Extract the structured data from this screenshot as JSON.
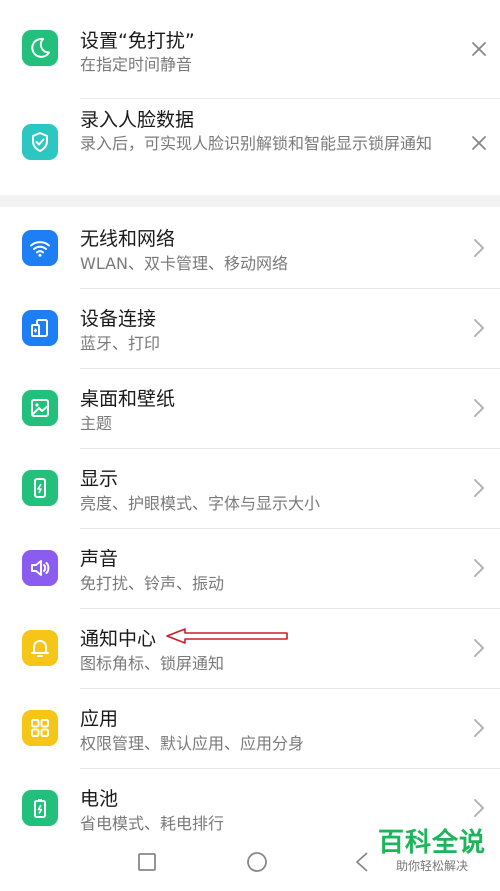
{
  "top_items": [
    {
      "title": "设置“免打扰”",
      "subtitle": "在指定时间静音",
      "icon": "moon-icon",
      "color": "#22c07a"
    },
    {
      "title": "录入人脸数据",
      "subtitle": "录入后，可实现人脸识别解锁和智能显示锁屏通知",
      "icon": "shield-check-icon",
      "color": "#2bc7c0"
    }
  ],
  "settings": [
    {
      "title": "无线和网络",
      "subtitle": "WLAN、双卡管理、移动网络",
      "icon": "wifi-icon",
      "color": "#1e7ef5"
    },
    {
      "title": "设备连接",
      "subtitle": "蓝牙、打印",
      "icon": "device-connect-icon",
      "color": "#1e7ef5"
    },
    {
      "title": "桌面和壁纸",
      "subtitle": "主题",
      "icon": "wallpaper-icon",
      "color": "#22c07a"
    },
    {
      "title": "显示",
      "subtitle": "亮度、护眼模式、字体与显示大小",
      "icon": "display-icon",
      "color": "#22c07a"
    },
    {
      "title": "声音",
      "subtitle": "免打扰、铃声、振动",
      "icon": "speaker-icon",
      "color": "#8a5cf0"
    },
    {
      "title": "通知中心",
      "subtitle": "图标角标、锁屏通知",
      "icon": "bell-icon",
      "color": "#f5c518"
    },
    {
      "title": "应用",
      "subtitle": "权限管理、默认应用、应用分身",
      "icon": "apps-grid-icon",
      "color": "#f5c518"
    },
    {
      "title": "电池",
      "subtitle": "省电模式、耗电排行",
      "icon": "battery-icon",
      "color": "#22c07a"
    }
  ],
  "watermark": {
    "title": "百科全说",
    "subtitle": "助你轻松解决"
  },
  "colors": {
    "annotation_arrow": "#cc1e2a",
    "watermark_green": "#1db45a"
  }
}
